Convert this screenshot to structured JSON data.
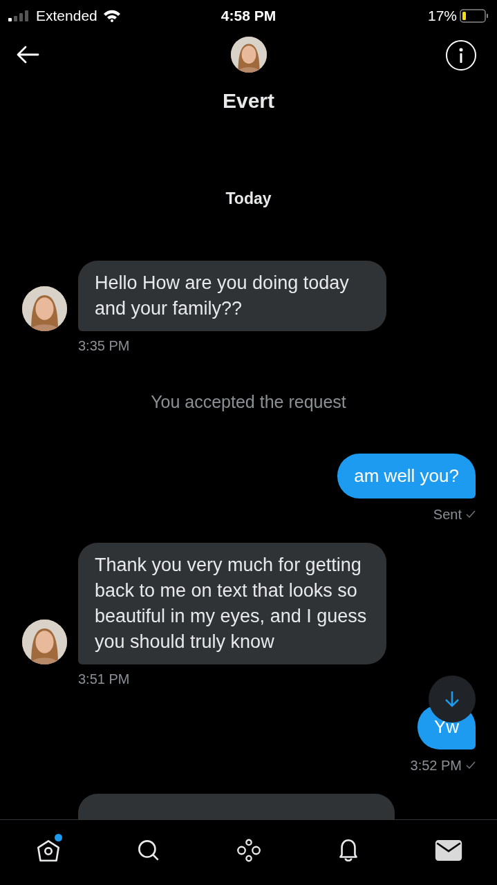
{
  "status_bar": {
    "carrier": "Extended",
    "time": "4:58 PM",
    "battery": "17%"
  },
  "header": {
    "name": "Evert"
  },
  "messages": [
    {
      "kind": "day",
      "text": "Today"
    },
    {
      "kind": "received",
      "text": "Hello How are you doing today and your family??",
      "time": "3:35 PM"
    },
    {
      "kind": "system",
      "text": "You accepted the request"
    },
    {
      "kind": "sent",
      "text": "am well you?",
      "time": "Sent",
      "scroll_button": false
    },
    {
      "kind": "received",
      "text": "Thank you very much for getting back to me on text that looks so beautiful in my eyes, and I guess you should truly know",
      "time": "3:51 PM"
    },
    {
      "kind": "sent",
      "text": "Yw",
      "time": "3:52 PM",
      "scroll_button": true
    },
    {
      "kind": "partial"
    }
  ],
  "nav": [
    {
      "kind": "home",
      "selected": false,
      "dot": true
    },
    {
      "kind": "search",
      "selected": false,
      "dot": false
    },
    {
      "kind": "spaces",
      "selected": false,
      "dot": false
    },
    {
      "kind": "notifications",
      "selected": false,
      "dot": false
    },
    {
      "kind": "messages",
      "selected": true,
      "dot": false
    }
  ]
}
